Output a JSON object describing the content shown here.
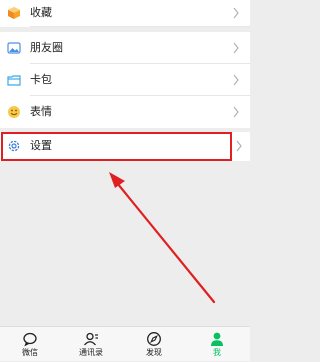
{
  "menu": {
    "items": [
      {
        "label": "收藏",
        "icon": "favorites-cube-icon"
      },
      {
        "label": "朋友圈",
        "icon": "moments-photo-icon"
      },
      {
        "label": "卡包",
        "icon": "card-wallet-icon"
      },
      {
        "label": "表情",
        "icon": "emoji-smiley-icon"
      },
      {
        "label": "设置",
        "icon": "settings-gear-icon"
      }
    ]
  },
  "tabbar": {
    "tabs": [
      {
        "label": "微信",
        "icon": "chat-bubble-icon",
        "active": false
      },
      {
        "label": "通讯录",
        "icon": "contacts-icon",
        "active": false
      },
      {
        "label": "发现",
        "icon": "compass-icon",
        "active": false
      },
      {
        "label": "我",
        "icon": "profile-person-icon",
        "active": true
      }
    ]
  },
  "colors": {
    "accent": "#07c160",
    "annotation": "#e02020",
    "background": "#ededed"
  }
}
